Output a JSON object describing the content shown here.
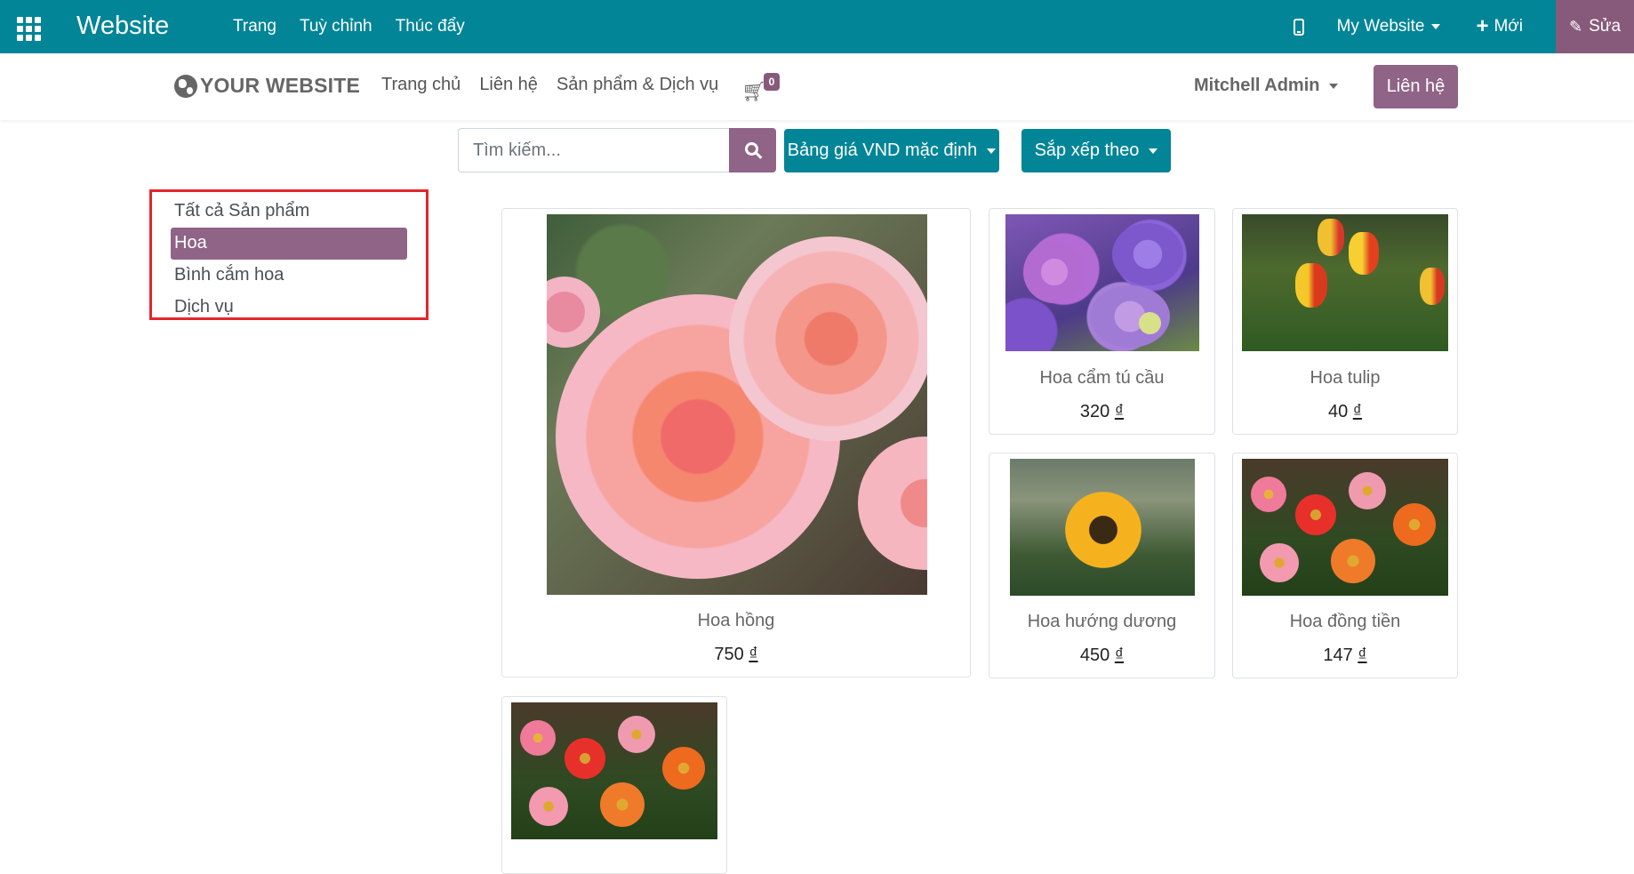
{
  "adminbar": {
    "brand": "Website",
    "menu": [
      "Trang",
      "Tuỳ chỉnh",
      "Thúc đẩy"
    ],
    "website_switch": "My Website",
    "new_label": "Mới",
    "edit_label": "Sửa"
  },
  "header": {
    "logo_text": "YOUR WEBSITE",
    "nav": [
      "Trang chủ",
      "Liên hệ",
      "Sản phẩm & Dịch vụ"
    ],
    "cart_count": "0",
    "user": "Mitchell Admin",
    "contact_button": "Liên hệ"
  },
  "filters": {
    "search_placeholder": "Tìm kiếm...",
    "pricelist": "Bảng giá VND mặc định",
    "sort": "Sắp xếp theo"
  },
  "categories": [
    "Tất cả Sản phẩm",
    "Hoa",
    "Bình cắm hoa",
    "Dịch vụ"
  ],
  "active_category": "Hoa",
  "products": [
    {
      "name": "Hoa hồng",
      "price": "750",
      "currency": "₫",
      "image": "pink-roses"
    },
    {
      "name": "Hoa cẩm tú cầu",
      "price": "320",
      "currency": "₫",
      "image": "purple-hydrangea"
    },
    {
      "name": "Hoa tulip",
      "price": "40",
      "currency": "₫",
      "image": "red-yellow-tulips"
    },
    {
      "name": "Hoa hướng dương",
      "price": "450",
      "currency": "₫",
      "image": "sunflower"
    },
    {
      "name": "Hoa đồng tiền",
      "price": "147",
      "currency": "₫",
      "image": "gerbera-daisies"
    },
    {
      "name": "",
      "price": "",
      "currency": "",
      "image": "gerbera-daisies"
    }
  ],
  "colors": {
    "adminbar": "#018597",
    "accent_purple": "#8f6487",
    "edit_button": "#875a7b",
    "highlight_box": "#e3262c"
  }
}
